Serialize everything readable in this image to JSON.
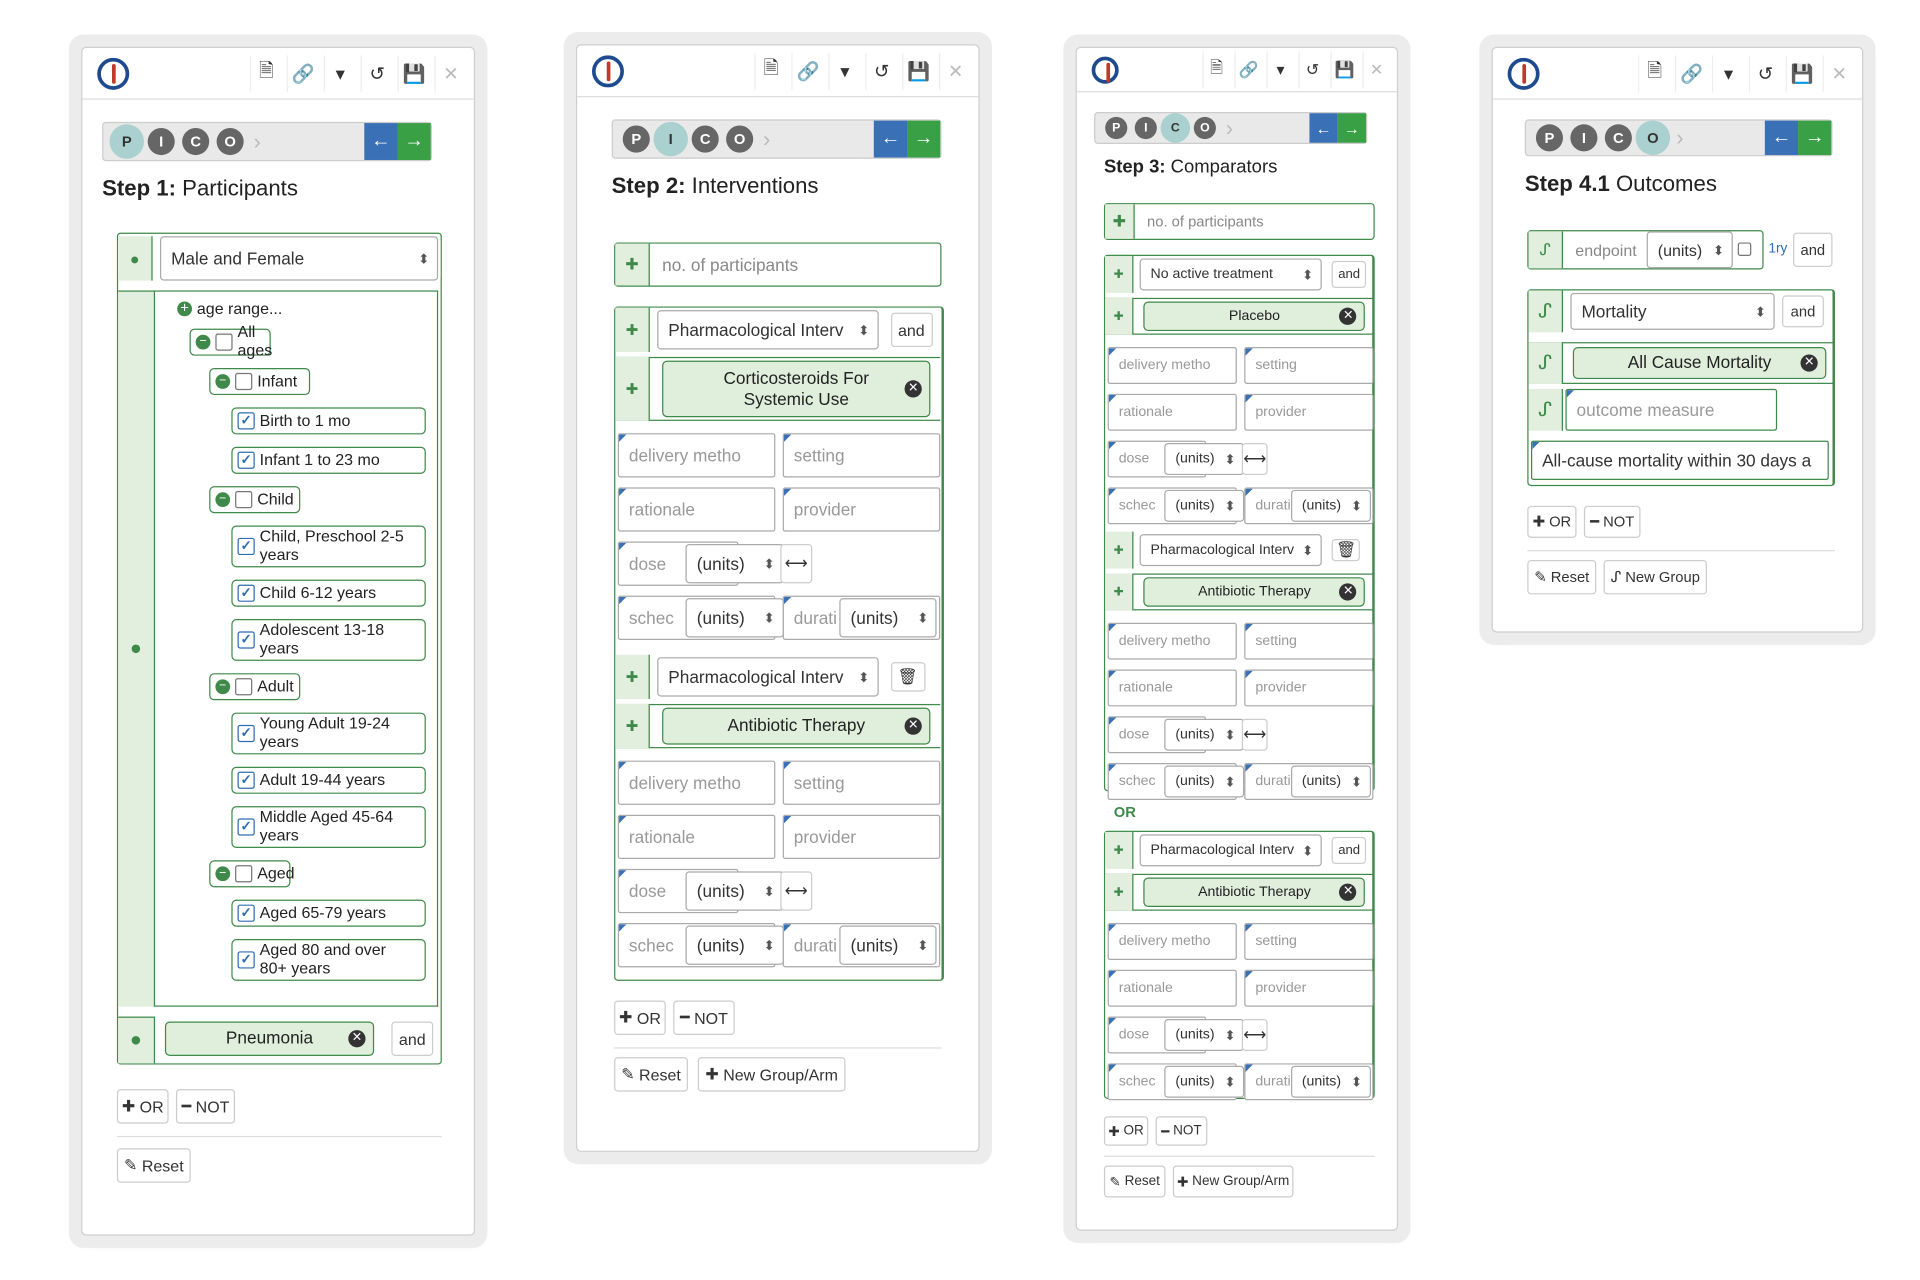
{
  "panel1": {
    "pico": [
      "P",
      "I",
      "C",
      "O"
    ],
    "step_num": "Step 1:",
    "step_name": " Participants",
    "gender_select": "Male and Female",
    "age_range_label": "age range...",
    "tree": [
      {
        "label": "All ages",
        "checked": false,
        "level": 0
      },
      {
        "label": "Infant",
        "checked": false,
        "level": 1
      },
      {
        "label": "Birth to 1 mo",
        "checked": true,
        "level": 2
      },
      {
        "label": "Infant 1 to 23 mo",
        "checked": true,
        "level": 2
      },
      {
        "label": "Child",
        "checked": false,
        "level": 1
      },
      {
        "label": "Child, Preschool 2-5 years",
        "checked": true,
        "level": 2
      },
      {
        "label": "Child 6-12 years",
        "checked": true,
        "level": 2
      },
      {
        "label": "Adolescent 13-18 years",
        "checked": true,
        "level": 2
      },
      {
        "label": "Adult",
        "checked": false,
        "level": 1
      },
      {
        "label": "Young Adult 19-24 years",
        "checked": true,
        "level": 2
      },
      {
        "label": "Adult 19-44 years",
        "checked": true,
        "level": 2
      },
      {
        "label": "Middle Aged 45-64 years",
        "checked": true,
        "level": 2
      },
      {
        "label": "Aged",
        "checked": false,
        "level": 1
      },
      {
        "label": "Aged 65-79 years",
        "checked": true,
        "level": 2
      },
      {
        "label": "Aged 80 and over 80+ years",
        "checked": true,
        "level": 2
      }
    ],
    "condition": "Pneumonia",
    "and": "and",
    "or": "OR",
    "not": "NOT",
    "reset": "Reset"
  },
  "panel2": {
    "step_num": "Step 2:",
    "step_name": " Interventions",
    "participants_placeholder": "no. of participants",
    "intervention_type": "Pharmacological Interv",
    "and": "and",
    "drug1": "Corticosteroids For Systemic Use",
    "drug2": "Antibiotic Therapy",
    "delivery": "delivery metho",
    "setting": "setting",
    "rationale": "rationale",
    "provider": "provider",
    "dose": "dose",
    "units": "(units)",
    "sched": "schec",
    "durat": "durati",
    "or": "OR",
    "not": "NOT",
    "reset": "Reset",
    "new_group": "New Group/Arm"
  },
  "panel3": {
    "step_num": "Step 3:",
    "step_name": " Comparators",
    "participants_placeholder": "no. of participants",
    "comparator_type": "No active treatment",
    "and": "and",
    "placebo": "Placebo",
    "intervention_type": "Pharmacological Interv",
    "drug": "Antibiotic Therapy",
    "delivery": "delivery metho",
    "setting": "setting",
    "rationale": "rationale",
    "provider": "provider",
    "dose": "dose",
    "units": "(units)",
    "sched": "schec",
    "durat": "durati",
    "or_label": "OR",
    "or": "OR",
    "not": "NOT",
    "reset": "Reset",
    "new_group": "New Group/Arm"
  },
  "panel4": {
    "step_num": "Step 4.1",
    "step_name": " Outcomes",
    "endpoint": "endpoint",
    "units": "(units)",
    "primary": "1ry",
    "and": "and",
    "outcome_select": "Mortality",
    "outcome_chip": "All Cause Mortality",
    "measure_placeholder": "outcome measure",
    "description": "All-cause mortality within 30 days a",
    "or": "OR",
    "not": "NOT",
    "reset": "Reset",
    "new_group": "New Group"
  }
}
